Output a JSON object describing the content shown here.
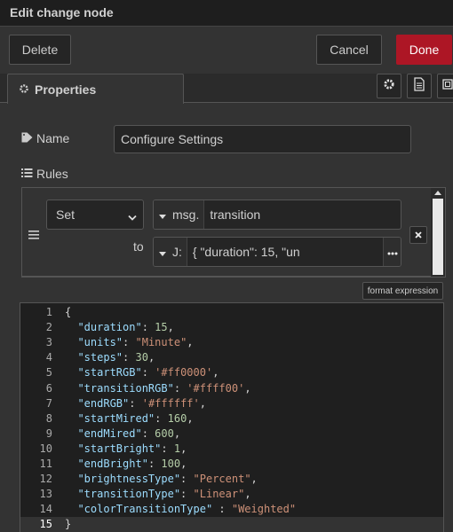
{
  "dialog": {
    "title": "Edit change node"
  },
  "buttons": {
    "delete": "Delete",
    "cancel": "Cancel",
    "done": "Done"
  },
  "tabs": {
    "properties": "Properties"
  },
  "fields": {
    "name_label": "Name",
    "name_value": "Configure Settings",
    "rules_label": "Rules"
  },
  "rule": {
    "action": "Set",
    "target_type": "msg.",
    "target_value": "transition",
    "to_label": "to",
    "value_type": "J:",
    "value_preview": "{          \"duration\": 15,              \"un"
  },
  "format_button": "format expression",
  "editor": {
    "lines": [
      {
        "n": "1",
        "t": "{"
      },
      {
        "n": "2",
        "t": "  \"duration\": 15,"
      },
      {
        "n": "3",
        "t": "  \"units\": \"Minute\","
      },
      {
        "n": "4",
        "t": "  \"steps\": 30,"
      },
      {
        "n": "5",
        "t": "  \"startRGB\": '#ff0000',"
      },
      {
        "n": "6",
        "t": "  \"transitionRGB\": '#ffff00',"
      },
      {
        "n": "7",
        "t": "  \"endRGB\": '#ffffff',"
      },
      {
        "n": "8",
        "t": "  \"startMired\": 160,"
      },
      {
        "n": "9",
        "t": "  \"endMired\": 600,"
      },
      {
        "n": "10",
        "t": "  \"startBright\": 1,"
      },
      {
        "n": "11",
        "t": "  \"endBright\": 100,"
      },
      {
        "n": "12",
        "t": "  \"brightnessType\": \"Percent\","
      },
      {
        "n": "13",
        "t": "  \"transitionType\": \"Linear\","
      },
      {
        "n": "14",
        "t": "  \"colorTransitionType\" : \"Weighted\""
      },
      {
        "n": "15",
        "t": "}"
      }
    ],
    "active_line": "15"
  },
  "colors": {
    "done": "#ad1625",
    "background": "#333333",
    "editor_bg": "#1f1f1f"
  }
}
